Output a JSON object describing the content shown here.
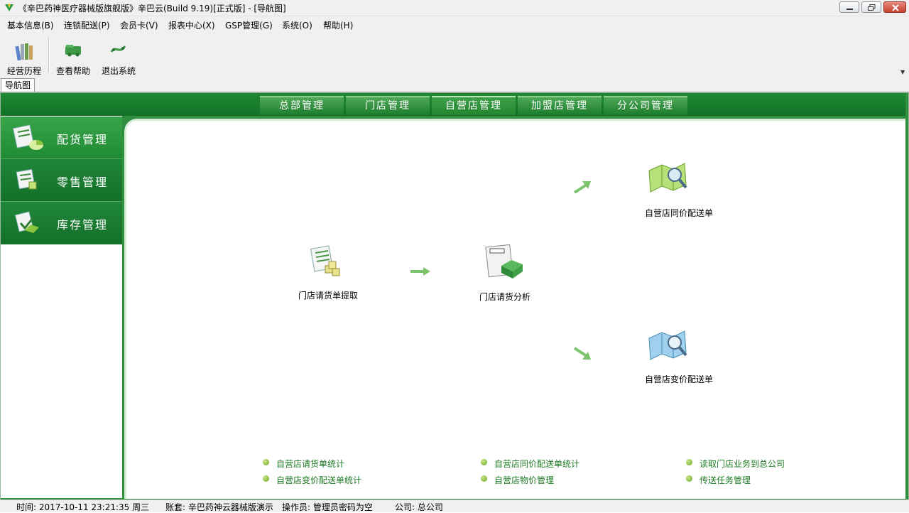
{
  "window": {
    "title": "《辛巴药神医疗器械版旗舰版》辛巴云(Build 9.19)[正式版] - [导航图]"
  },
  "menu": [
    "基本信息(B)",
    "连锁配送(P)",
    "会员卡(V)",
    "报表中心(X)",
    "GSP管理(G)",
    "系统(O)",
    "帮助(H)"
  ],
  "toolbar": {
    "history_label": "经营历程",
    "help_label": "查看帮助",
    "exit_label": "退出系统"
  },
  "nav_tab": "导航图",
  "top_tabs": [
    "总部管理",
    "门店管理",
    "自营店管理",
    "加盟店管理",
    "分公司管理"
  ],
  "active_top_tab": "自营店管理",
  "sidebar": [
    {
      "label": "配货管理",
      "icon": "distribution-icon"
    },
    {
      "label": "零售管理",
      "icon": "retail-icon"
    },
    {
      "label": "库存管理",
      "icon": "inventory-icon"
    }
  ],
  "flow": {
    "request_extract": "门店请货单提取",
    "request_analysis": "门店请货分析",
    "same_price_delivery": "自营店同价配送单",
    "changed_price_delivery": "自营店变价配送单"
  },
  "links": [
    "自营店请货单统计",
    "自营店变价配送单统计",
    "自营店同价配送单统计",
    "自营店物价管理",
    "读取门店业务到总公司",
    "传送任务管理"
  ],
  "status": {
    "time": "时间: 2017-10-11 23:21:35 周三",
    "account": "账套: 辛巴药神云器械版演示",
    "operator": "操作员: 管理员密码为空",
    "company": "公司: 总公司"
  },
  "colors": {
    "brand_green": "#1f8a33",
    "link_green": "#1d7a22"
  }
}
